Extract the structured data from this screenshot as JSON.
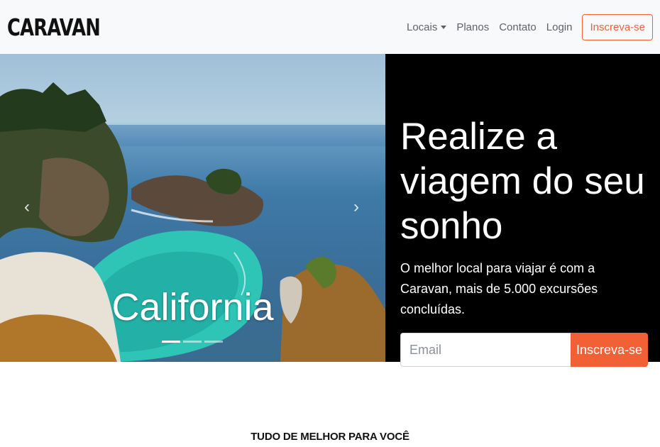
{
  "navbar": {
    "brand": "CARAVAN",
    "links": [
      {
        "label": "Locais",
        "dropdown": true
      },
      {
        "label": "Planos"
      },
      {
        "label": "Contato"
      },
      {
        "label": "Login"
      }
    ],
    "cta_label": "Inscreva-se"
  },
  "carousel": {
    "caption": "California",
    "prev_icon": "chevron-left-icon",
    "next_icon": "chevron-right-icon",
    "slides_count": 3,
    "active_slide": 1
  },
  "hero": {
    "title": "Realize a viagem do seu sonho",
    "lead": "O melhor local para viajar é com a Caravan, mais de 5.000 excursões concluídas.",
    "email_placeholder": "Email",
    "button_label": "Inscreva-se"
  },
  "section": {
    "title": "TUDO DE MELHOR PARA VOCÊ"
  },
  "colors": {
    "accent": "#f26035",
    "navbar_bg": "#f8f9fa",
    "panel_bg": "#000000"
  }
}
